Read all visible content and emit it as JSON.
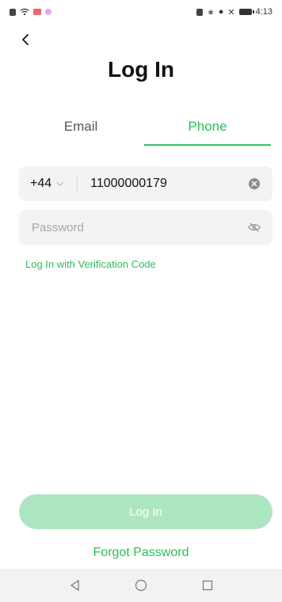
{
  "status_bar": {
    "time": "4:13"
  },
  "page": {
    "title": "Log In"
  },
  "tabs": [
    {
      "label": "Email",
      "active": false
    },
    {
      "label": "Phone",
      "active": true
    }
  ],
  "phone": {
    "country_code": "+44",
    "number": "11000000179"
  },
  "password": {
    "placeholder": "Password"
  },
  "links": {
    "verification_code": "Log In with Verification Code",
    "forgot_password": "Forgot Password"
  },
  "buttons": {
    "login_label": "Log In"
  },
  "colors": {
    "accent": "#2ebd5a",
    "disabled_button": "#aee5c1",
    "field_bg": "#f3f3f3"
  },
  "icons": {
    "back": "chevron-left-icon",
    "clear": "clear-circle-icon",
    "visibility": "eye-off-icon",
    "dropdown": "chevron-down-icon"
  }
}
